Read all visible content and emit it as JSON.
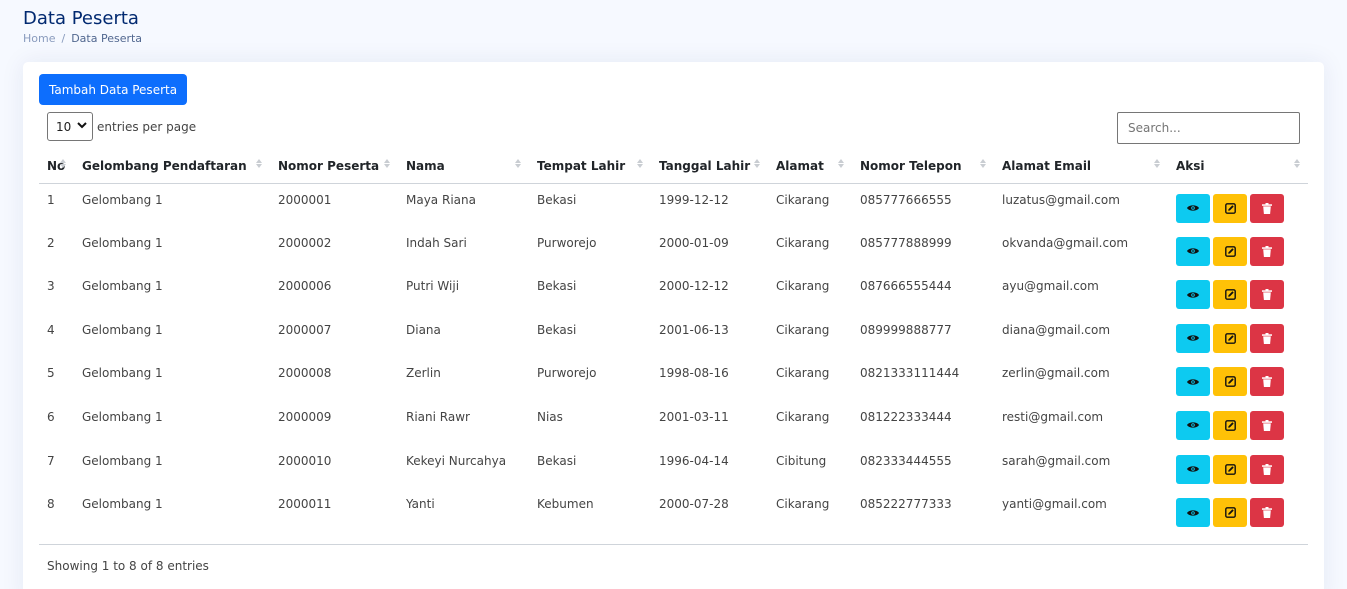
{
  "header": {
    "title": "Data Peserta",
    "breadcrumb": {
      "home": "Home",
      "separator": "/",
      "current": "Data Peserta"
    }
  },
  "toolbar": {
    "add_label": "Tambah Data Peserta",
    "page_size": "10",
    "entries_label": "entries per page",
    "search_placeholder": "Search..."
  },
  "table": {
    "columns": [
      "No",
      "Gelombang Pendaftaran",
      "Nomor Peserta",
      "Nama",
      "Tempat Lahir",
      "Tanggal Lahir",
      "Alamat",
      "Nomor Telepon",
      "Alamat Email",
      "Aksi"
    ],
    "rows": [
      [
        "1",
        "Gelombang 1",
        "2000001",
        "Maya Riana",
        "Bekasi",
        "1999-12-12",
        "Cikarang",
        "085777666555",
        "luzatus@gmail.com"
      ],
      [
        "2",
        "Gelombang 1",
        "2000002",
        "Indah Sari",
        "Purworejo",
        "2000-01-09",
        "Cikarang",
        "085777888999",
        "okvanda@gmail.com"
      ],
      [
        "3",
        "Gelombang 1",
        "2000006",
        "Putri Wiji",
        "Bekasi",
        "2000-12-12",
        "Cikarang",
        "087666555444",
        "ayu@gmail.com"
      ],
      [
        "4",
        "Gelombang 1",
        "2000007",
        "Diana",
        "Bekasi",
        "2001-06-13",
        "Cikarang",
        "089999888777",
        "diana@gmail.com"
      ],
      [
        "5",
        "Gelombang 1",
        "2000008",
        "Zerlin",
        "Purworejo",
        "1998-08-16",
        "Cikarang",
        "0821333111444",
        "zerlin@gmail.com"
      ],
      [
        "6",
        "Gelombang 1",
        "2000009",
        "Riani Rawr",
        "Nias",
        "2001-03-11",
        "Cikarang",
        "081222333444",
        "resti@gmail.com"
      ],
      [
        "7",
        "Gelombang 1",
        "2000010",
        "Kekeyi Nurcahya",
        "Bekasi",
        "1996-04-14",
        "Cibitung",
        "082333444555",
        "sarah@gmail.com"
      ],
      [
        "8",
        "Gelombang 1",
        "2000011",
        "Yanti",
        "Kebumen",
        "2000-07-28",
        "Cikarang",
        "085222777333",
        "yanti@gmail.com"
      ]
    ],
    "action_icons": [
      "eye-icon",
      "pencil-square-icon",
      "trash-icon"
    ]
  },
  "footer": {
    "info": "Showing 1 to 8 of 8 entries"
  },
  "colors": {
    "primary": "#0d6efd",
    "view": "#0dcaf0",
    "edit": "#ffc107",
    "delete": "#dc3545",
    "title": "#012970"
  }
}
